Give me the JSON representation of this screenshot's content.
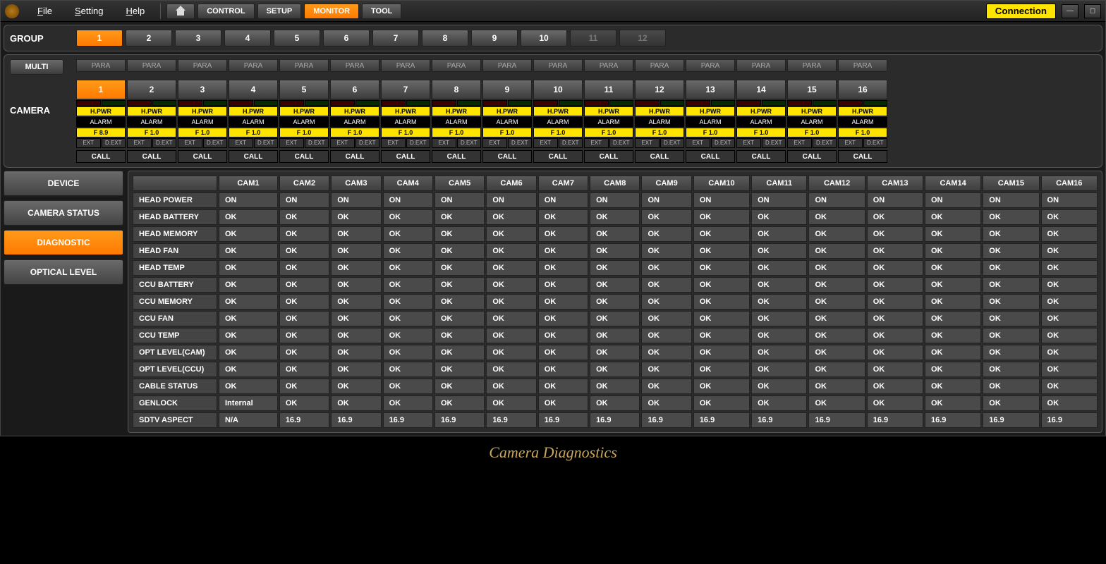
{
  "menu": {
    "file": "File",
    "setting": "Setting",
    "help": "Help"
  },
  "toolbar": {
    "control": "CONTROL",
    "setup": "SETUP",
    "monitor": "MONITOR",
    "tool": "TOOL",
    "connection": "Connection"
  },
  "group": {
    "label": "GROUP",
    "items": [
      "1",
      "2",
      "3",
      "4",
      "5",
      "6",
      "7",
      "8",
      "9",
      "10",
      "11",
      "12"
    ],
    "selected": 0,
    "disabled": [
      10,
      11
    ]
  },
  "camera": {
    "multi": "MULTI",
    "label": "CAMERA",
    "para": "PARA",
    "count": 16,
    "selected": 0,
    "tags": {
      "hpwr": "H.PWR",
      "alarm": "ALARM",
      "ext": "EXT",
      "dext": "D.EXT",
      "call": "CALL"
    },
    "fvals": [
      "F 8.9",
      "F 1.0",
      "F 1.0",
      "F 1.0",
      "F 1.0",
      "F 1.0",
      "F 1.0",
      "F 1.0",
      "F 1.0",
      "F 1.0",
      "F 1.0",
      "F 1.0",
      "F 1.0",
      "F 1.0",
      "F 1.0",
      "F 1.0"
    ]
  },
  "sidebar": {
    "device": "DEVICE",
    "camera_status": "CAMERA STATUS",
    "diagnostic": "DIAGNOSTIC",
    "optical_level": "OPTICAL LEVEL"
  },
  "table": {
    "cols": [
      "CAM1",
      "CAM2",
      "CAM3",
      "CAM4",
      "CAM5",
      "CAM6",
      "CAM7",
      "CAM8",
      "CAM9",
      "CAM10",
      "CAM11",
      "CAM12",
      "CAM13",
      "CAM14",
      "CAM15",
      "CAM16"
    ],
    "rows": [
      {
        "h": "HEAD POWER",
        "v": [
          "ON",
          "ON",
          "ON",
          "ON",
          "ON",
          "ON",
          "ON",
          "ON",
          "ON",
          "ON",
          "ON",
          "ON",
          "ON",
          "ON",
          "ON",
          "ON"
        ]
      },
      {
        "h": "HEAD BATTERY",
        "v": [
          "OK",
          "OK",
          "OK",
          "OK",
          "OK",
          "OK",
          "OK",
          "OK",
          "OK",
          "OK",
          "OK",
          "OK",
          "OK",
          "OK",
          "OK",
          "OK"
        ]
      },
      {
        "h": "HEAD MEMORY",
        "v": [
          "OK",
          "OK",
          "OK",
          "OK",
          "OK",
          "OK",
          "OK",
          "OK",
          "OK",
          "OK",
          "OK",
          "OK",
          "OK",
          "OK",
          "OK",
          "OK"
        ]
      },
      {
        "h": "HEAD FAN",
        "v": [
          "OK",
          "OK",
          "OK",
          "OK",
          "OK",
          "OK",
          "OK",
          "OK",
          "OK",
          "OK",
          "OK",
          "OK",
          "OK",
          "OK",
          "OK",
          "OK"
        ]
      },
      {
        "h": "HEAD TEMP",
        "v": [
          "OK",
          "OK",
          "OK",
          "OK",
          "OK",
          "OK",
          "OK",
          "OK",
          "OK",
          "OK",
          "OK",
          "OK",
          "OK",
          "OK",
          "OK",
          "OK"
        ]
      },
      {
        "h": "CCU BATTERY",
        "v": [
          "OK",
          "OK",
          "OK",
          "OK",
          "OK",
          "OK",
          "OK",
          "OK",
          "OK",
          "OK",
          "OK",
          "OK",
          "OK",
          "OK",
          "OK",
          "OK"
        ]
      },
      {
        "h": "CCU MEMORY",
        "v": [
          "OK",
          "OK",
          "OK",
          "OK",
          "OK",
          "OK",
          "OK",
          "OK",
          "OK",
          "OK",
          "OK",
          "OK",
          "OK",
          "OK",
          "OK",
          "OK"
        ]
      },
      {
        "h": "CCU FAN",
        "v": [
          "OK",
          "OK",
          "OK",
          "OK",
          "OK",
          "OK",
          "OK",
          "OK",
          "OK",
          "OK",
          "OK",
          "OK",
          "OK",
          "OK",
          "OK",
          "OK"
        ]
      },
      {
        "h": "CCU TEMP",
        "v": [
          "OK",
          "OK",
          "OK",
          "OK",
          "OK",
          "OK",
          "OK",
          "OK",
          "OK",
          "OK",
          "OK",
          "OK",
          "OK",
          "OK",
          "OK",
          "OK"
        ]
      },
      {
        "h": "OPT LEVEL(CAM)",
        "v": [
          "OK",
          "OK",
          "OK",
          "OK",
          "OK",
          "OK",
          "OK",
          "OK",
          "OK",
          "OK",
          "OK",
          "OK",
          "OK",
          "OK",
          "OK",
          "OK"
        ]
      },
      {
        "h": "OPT LEVEL(CCU)",
        "v": [
          "OK",
          "OK",
          "OK",
          "OK",
          "OK",
          "OK",
          "OK",
          "OK",
          "OK",
          "OK",
          "OK",
          "OK",
          "OK",
          "OK",
          "OK",
          "OK"
        ]
      },
      {
        "h": "CABLE STATUS",
        "v": [
          "OK",
          "OK",
          "OK",
          "OK",
          "OK",
          "OK",
          "OK",
          "OK",
          "OK",
          "OK",
          "OK",
          "OK",
          "OK",
          "OK",
          "OK",
          "OK"
        ]
      },
      {
        "h": "GENLOCK",
        "v": [
          "Internal",
          "OK",
          "OK",
          "OK",
          "OK",
          "OK",
          "OK",
          "OK",
          "OK",
          "OK",
          "OK",
          "OK",
          "OK",
          "OK",
          "OK",
          "OK"
        ]
      },
      {
        "h": "SDTV ASPECT",
        "v": [
          "N/A",
          "16.9",
          "16.9",
          "16.9",
          "16.9",
          "16.9",
          "16.9",
          "16.9",
          "16.9",
          "16.9",
          "16.9",
          "16.9",
          "16.9",
          "16.9",
          "16.9",
          "16.9"
        ]
      }
    ]
  },
  "caption": "Camera Diagnostics"
}
